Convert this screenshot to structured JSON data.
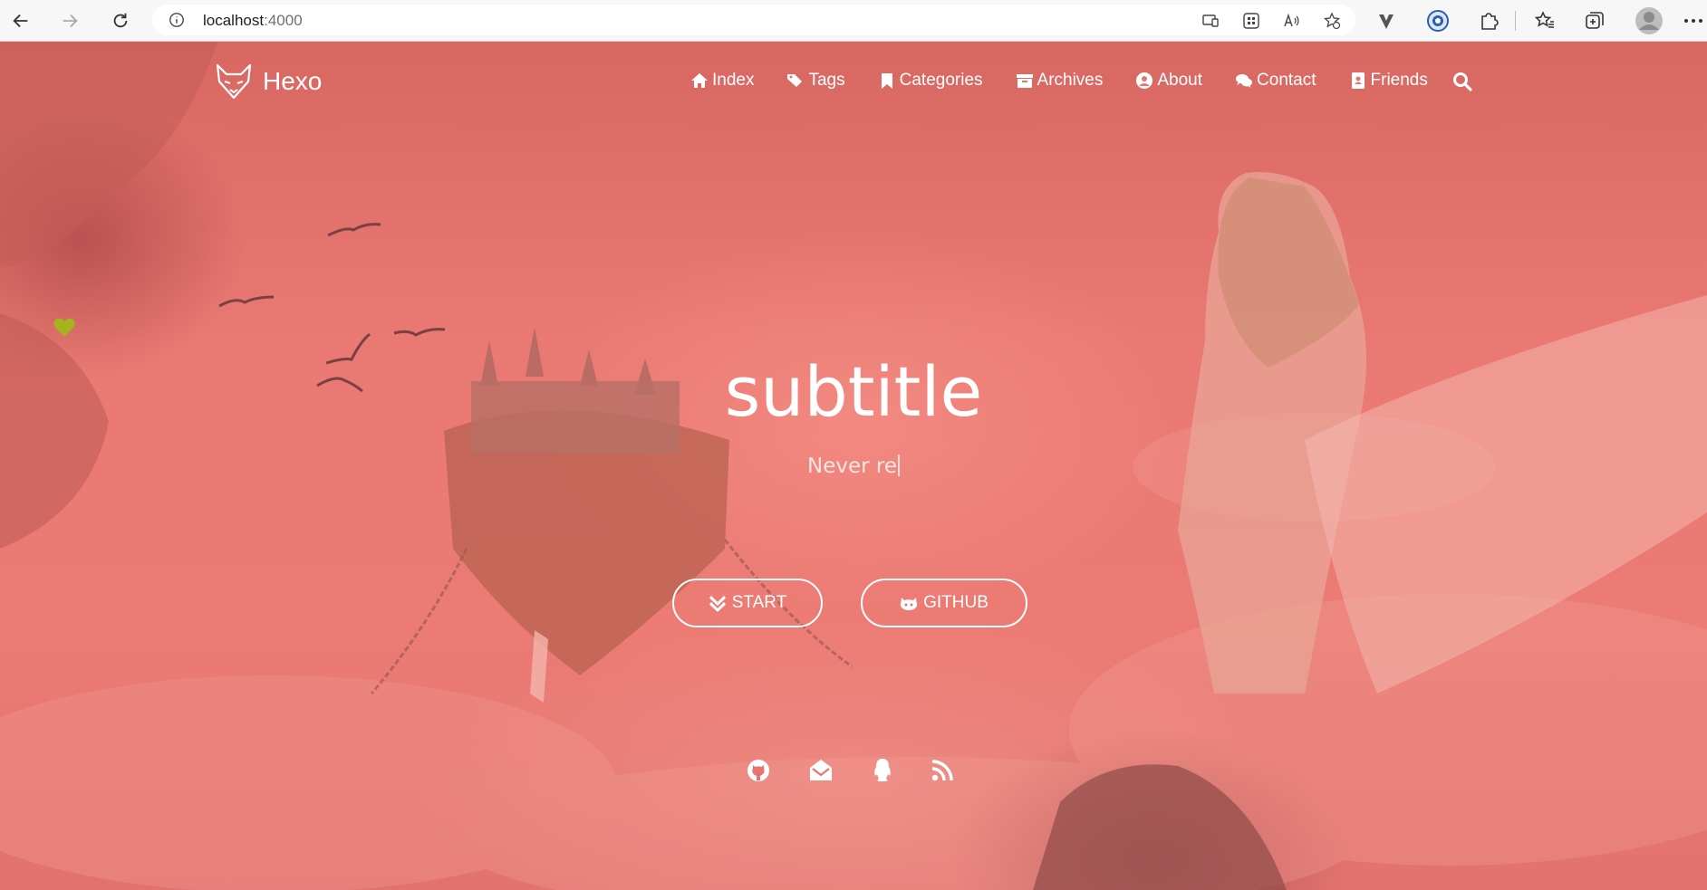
{
  "browser": {
    "url_host": "localhost",
    "url_port": ":4000",
    "icons": [
      "back-icon",
      "forward-icon",
      "reload-icon",
      "info-icon",
      "app-available-icon",
      "grid-icon",
      "read-aloud-icon",
      "add-favorite-icon",
      "extension-v-icon",
      "edge-shield-icon",
      "extensions-icon",
      "favorites-icon",
      "collections-icon",
      "profile-icon",
      "more-icon"
    ]
  },
  "site": {
    "logo_text": "Hexo",
    "nav": [
      {
        "label": "Index",
        "icon": "home-icon"
      },
      {
        "label": "Tags",
        "icon": "tags-icon"
      },
      {
        "label": "Categories",
        "icon": "bookmark-icon"
      },
      {
        "label": "Archives",
        "icon": "archive-icon"
      },
      {
        "label": "About",
        "icon": "user-circle-icon"
      },
      {
        "label": "Contact",
        "icon": "comments-icon"
      },
      {
        "label": "Friends",
        "icon": "address-book-icon"
      }
    ],
    "search_icon": "search-icon"
  },
  "hero": {
    "title": "subtitle",
    "subtitle": "Never re",
    "buttons": [
      {
        "label": "START",
        "icon": "double-chevron-down-icon"
      },
      {
        "label": "GITHUB",
        "icon": "github-alt-icon"
      }
    ],
    "social_icons": [
      "github-icon",
      "envelope-open-icon",
      "qq-icon",
      "rss-icon"
    ]
  },
  "colors": {
    "overlay": "#e87470",
    "heart": "#a4b31e",
    "text": "#ffffff"
  }
}
